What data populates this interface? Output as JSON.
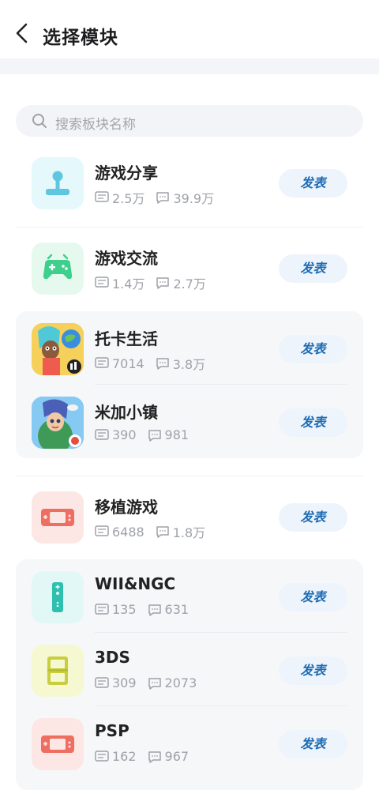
{
  "header": {
    "title": "选择模块"
  },
  "search": {
    "placeholder": "搜索板块名称"
  },
  "post_label": "发表",
  "items": [
    {
      "name": "游戏分享",
      "views": "2.5万",
      "comments": "39.9万",
      "icon": "joystick-icon",
      "color": "#5ec6e0"
    },
    {
      "name": "游戏交流",
      "views": "1.4万",
      "comments": "2.7万",
      "icon": "gamepad-icon",
      "color": "#3fcf8d"
    },
    {
      "name": "托卡生活",
      "views": "7014",
      "comments": "3.8万",
      "icon": "toca-life-app-icon"
    },
    {
      "name": "米加小镇",
      "views": "390",
      "comments": "981",
      "icon": "miga-town-app-icon"
    },
    {
      "name": "移植游戏",
      "views": "6488",
      "comments": "1.8万",
      "icon": "handheld-console-icon",
      "color": "#ef6e62"
    },
    {
      "name": "WII&NGC",
      "views": "135",
      "comments": "631",
      "icon": "wii-remote-icon",
      "color": "#2fbfae"
    },
    {
      "name": "3DS",
      "views": "309",
      "comments": "2073",
      "icon": "3ds-console-icon",
      "color": "#c9cf3c"
    },
    {
      "name": "PSP",
      "views": "162",
      "comments": "967",
      "icon": "psp-console-icon",
      "color": "#ef6e62"
    }
  ]
}
